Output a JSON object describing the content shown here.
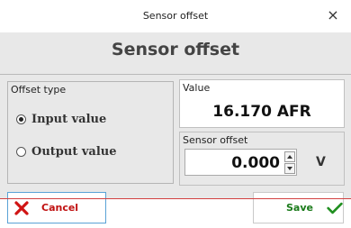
{
  "window": {
    "title": "Sensor offset",
    "close_glyph": "×"
  },
  "dialog": {
    "heading": "Sensor offset",
    "offset_type": {
      "label": "Offset type",
      "options": [
        {
          "label": "Input value",
          "selected": true
        },
        {
          "label": "Output value",
          "selected": false
        }
      ]
    },
    "value": {
      "label": "Value",
      "text": "16.170 AFR"
    },
    "sensor_offset": {
      "label": "Sensor offset",
      "value": "0.000",
      "unit": "V"
    }
  },
  "buttons": {
    "cancel": {
      "label": "Cancel",
      "icon": "x-icon",
      "color": "#d01414"
    },
    "save": {
      "label": "Save",
      "icon": "check-icon",
      "color": "#1f8f1f"
    }
  }
}
